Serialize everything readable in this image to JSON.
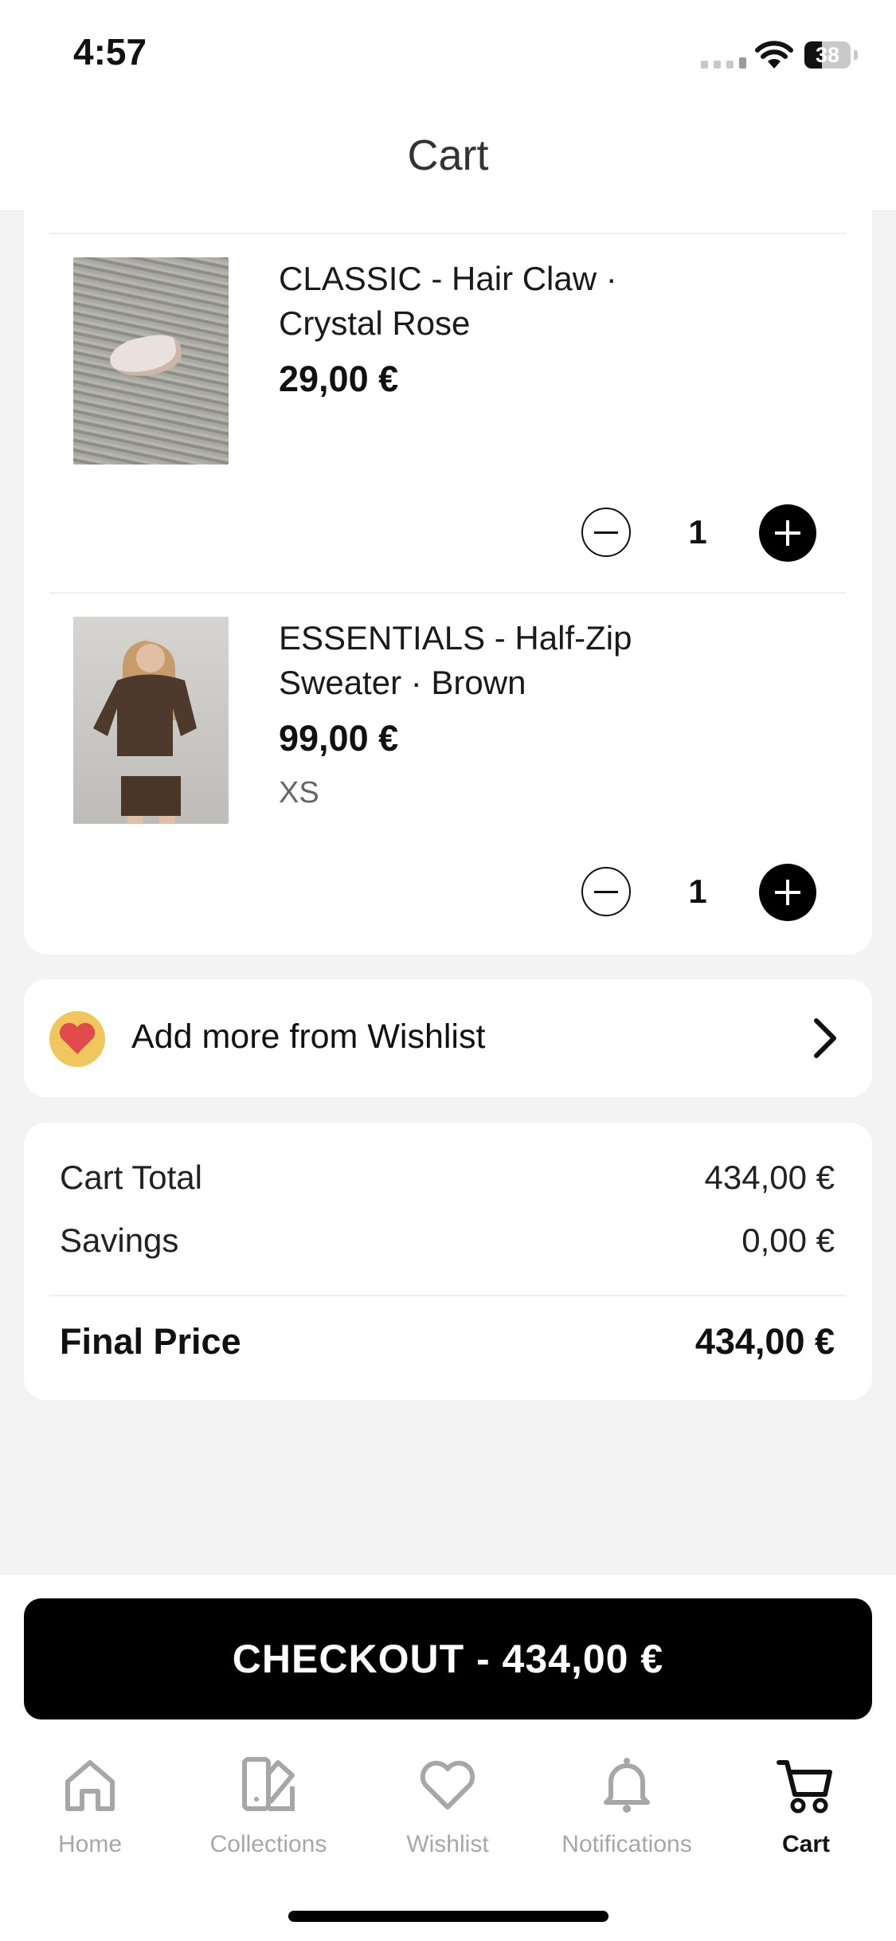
{
  "status_bar": {
    "time": "4:57",
    "battery": "38"
  },
  "header": {
    "title": "Cart"
  },
  "cart_items": [
    {
      "name_line1": "CLASSIC - Hair Claw ·",
      "name_line2": "Crystal Rose",
      "price": "29,00 €",
      "size": "",
      "quantity": "1"
    },
    {
      "name_line1": "ESSENTIALS - Half-Zip",
      "name_line2": "Sweater · Brown",
      "price": "99,00 €",
      "size": "XS",
      "quantity": "1"
    }
  ],
  "wishlist_link": {
    "label": "Add more from Wishlist"
  },
  "summary": {
    "cart_total_label": "Cart Total",
    "cart_total_value": "434,00 €",
    "savings_label": "Savings",
    "savings_value": "0,00 €",
    "final_label": "Final Price",
    "final_value": "434,00 €"
  },
  "checkout_button": {
    "label": "CHECKOUT - 434,00 €"
  },
  "tab_bar": {
    "tabs": [
      {
        "label": "Home",
        "icon": "home-icon"
      },
      {
        "label": "Collections",
        "icon": "collections-icon"
      },
      {
        "label": "Wishlist",
        "icon": "heart-icon"
      },
      {
        "label": "Notifications",
        "icon": "bell-icon"
      },
      {
        "label": "Cart",
        "icon": "cart-icon",
        "active": true
      }
    ]
  },
  "colors": {
    "accent": "#000000",
    "inactive_tab": "#a7a7a7",
    "background": "#f3f3f3",
    "wishlist_badge": "#f0c75c",
    "heart": "#e24b4b"
  }
}
